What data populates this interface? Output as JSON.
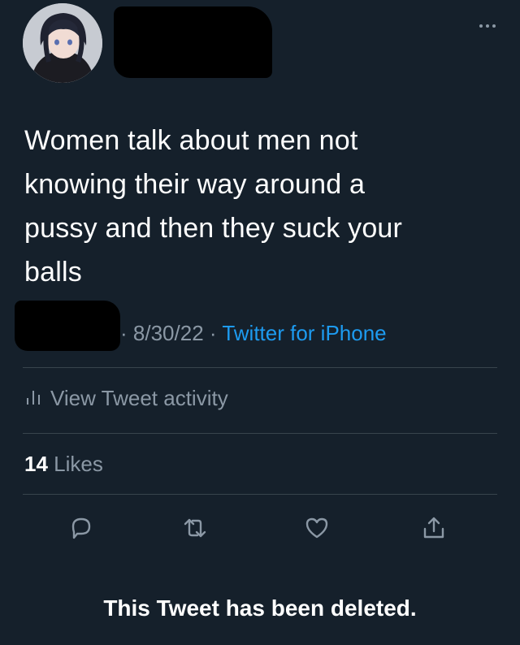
{
  "tweet": {
    "text_lines": [
      "Women talk about men not",
      "knowing their way around a",
      "pussy and then they suck your",
      "balls"
    ],
    "date": "8/30/22",
    "separator": "·",
    "source": "Twitter for iPhone"
  },
  "activity": {
    "label": "View Tweet activity",
    "icon": "bar-chart-icon"
  },
  "likes": {
    "count": "14",
    "label": "Likes"
  },
  "actions": {
    "icons": [
      "reply-icon",
      "retweet-icon",
      "like-icon",
      "share-icon"
    ]
  },
  "overlay": {
    "caption": "This Tweet has been deleted."
  },
  "colors": {
    "background": "#15202b",
    "text": "#ffffff",
    "muted": "#8b98a5",
    "link": "#1d9bf0",
    "divider": "#38444d"
  }
}
